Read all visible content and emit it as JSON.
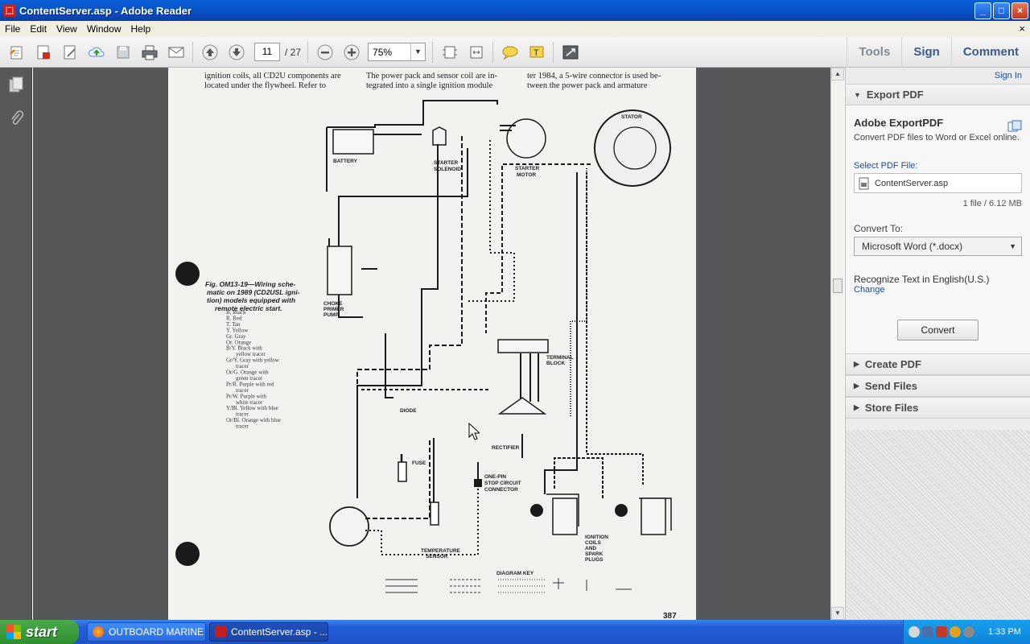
{
  "window": {
    "title": "ContentServer.asp - Adobe Reader",
    "minimize": "_",
    "maximize": "□",
    "close": "×"
  },
  "menu": [
    "File",
    "Edit",
    "View",
    "Window",
    "Help"
  ],
  "menu_close": "×",
  "toolbar": {
    "current_page": "11",
    "total_pages": "/ 27",
    "zoom": "75%",
    "tools_label": "Tools",
    "sign_label": "Sign",
    "comment_label": "Comment"
  },
  "document": {
    "top_text_col1_line1": "ignition coils, all CD2U components are",
    "top_text_col1_line2": "located under the flywheel. Refer to",
    "top_text_col2_line1": "The power pack and sensor coil are in-",
    "top_text_col2_line2": "tegrated into a single ignition module",
    "top_text_col3_line1": "ter 1984, a 5-wire connector is used be-",
    "top_text_col3_line2": "tween the power pack and armature",
    "figure_caption_1": "Fig. OM13-19—Wiring sche-",
    "figure_caption_2": "matic on 1989 (CD2USL igni-",
    "figure_caption_3": "tion) models equipped with",
    "figure_caption_4": "remote electric start.",
    "legend": [
      "B. Black",
      "R. Red",
      "T. Tan",
      "Y. Yellow",
      "Gr. Gray",
      "Or. Orange",
      "B/Y. Black with",
      "yellow tracer",
      "Gr/Y. Gray with yellow",
      "tracer",
      "Or/G. Orange with",
      "green tracer",
      "Pr/R. Purple with red",
      "tracer",
      "Pr/W. Purple with",
      "white tracer",
      "Y/Bl. Yellow with blue",
      "tracer",
      "Or/Bl. Orange with blue",
      "tracer"
    ],
    "labels": {
      "battery": "BATTERY",
      "starter_solenoid_1": "STARTER",
      "starter_solenoid_2": "SOLENOID",
      "starter_motor_1": "STARTER",
      "starter_motor_2": "MOTOR",
      "stator": "STATOR",
      "choke_1": "CHOKE",
      "choke_2": "PRIMER",
      "choke_3": "PUMP",
      "terminal_block_1": "TERMINAL",
      "terminal_block_2": "BLOCK",
      "diode": "DIODE",
      "rectifier": "RECTIFIER",
      "fuse": "FUSE",
      "stop_1": "ONE-PIN",
      "stop_2": "STOP CIRCUIT",
      "stop_3": "CONNECTOR",
      "temp_1": "TEMPERATURE",
      "temp_2": "SENSOR",
      "ign_1": "IGNITION",
      "ign_2": "COILS",
      "ign_3": "AND",
      "ign_4": "SPARK",
      "ign_5": "PLUGS",
      "diagram_key": "DIAGRAM KEY"
    },
    "page_number": "387"
  },
  "right_panel": {
    "sign_in": "Sign In",
    "export_pdf": "Export PDF",
    "adobe_exportpdf": "Adobe ExportPDF",
    "convert_desc": "Convert PDF files to Word or Excel online.",
    "select_pdf_file": "Select PDF File:",
    "file_name": "ContentServer.asp",
    "file_info": "1 file / 6.12 MB",
    "convert_to": "Convert To:",
    "convert_format": "Microsoft Word (*.docx)",
    "recognize_text": "Recognize Text in English(U.S.)",
    "change": "Change",
    "convert_button": "Convert",
    "create_pdf": "Create PDF",
    "send_files": "Send Files",
    "store_files": "Store Files"
  },
  "taskbar": {
    "start": "start",
    "task1": "OUTBOARD MARINE ...",
    "task2": "ContentServer.asp - ...",
    "clock": "1:33 PM"
  },
  "colors": {
    "titlebar": "#0a4fc4",
    "doc_background": "#555759",
    "taskbar": "#245dd7",
    "start_button": "#2f8f2f"
  }
}
